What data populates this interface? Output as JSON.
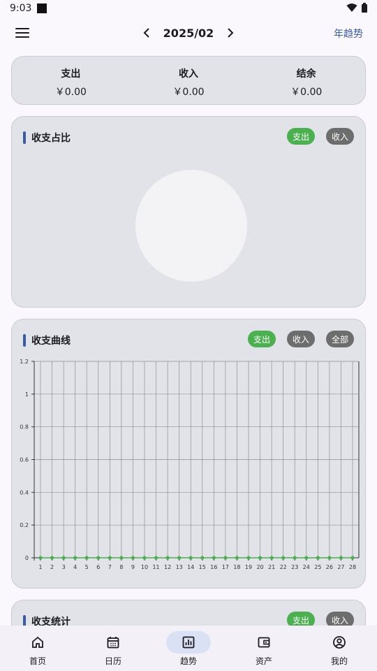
{
  "status": {
    "time": "9:03"
  },
  "header": {
    "month": "2025/02",
    "prev_icon": "chevron-left-icon",
    "next_icon": "chevron-right-icon",
    "year_trend": "年趋势"
  },
  "summary": [
    {
      "label": "支出",
      "value": "￥0.00"
    },
    {
      "label": "收入",
      "value": "￥0.00"
    },
    {
      "label": "结余",
      "value": "￥0.00"
    }
  ],
  "ratio_card": {
    "title": "收支占比",
    "chips": [
      "支出",
      "收入"
    ],
    "active": "支出"
  },
  "curve_card": {
    "title": "收支曲线",
    "chips": [
      "支出",
      "收入",
      "全部"
    ],
    "active": "支出"
  },
  "stat_card": {
    "title": "收支统计",
    "chips": [
      "支出",
      "收入"
    ],
    "active": "支出"
  },
  "chart_data": {
    "type": "line",
    "x": [
      1,
      2,
      3,
      4,
      5,
      6,
      7,
      8,
      9,
      10,
      11,
      12,
      13,
      14,
      15,
      16,
      17,
      18,
      19,
      20,
      21,
      22,
      23,
      24,
      25,
      26,
      27,
      28
    ],
    "series": [
      {
        "values": [
          0,
          0,
          0,
          0,
          0,
          0,
          0,
          0,
          0,
          0,
          0,
          0,
          0,
          0,
          0,
          0,
          0,
          0,
          0,
          0,
          0,
          0,
          0,
          0,
          0,
          0,
          0,
          0
        ],
        "color": "#4caf50"
      }
    ],
    "ylim": [
      0,
      1.2
    ],
    "yticks": [
      "0",
      "0.2",
      "0.4",
      "0.6",
      "0.8",
      "1",
      "1.2"
    ],
    "grid": true
  },
  "nav": [
    {
      "label": "首页",
      "icon": "home-icon"
    },
    {
      "label": "日历",
      "icon": "calendar-icon"
    },
    {
      "label": "趋势",
      "icon": "chart-icon",
      "active": true
    },
    {
      "label": "资产",
      "icon": "wallet-icon"
    },
    {
      "label": "我的",
      "icon": "profile-icon"
    }
  ],
  "colors": {
    "accent": "#3b5ba5",
    "active_chip": "#4caf50",
    "inactive_chip": "#6d6d6d",
    "card_bg": "#e2e3e8"
  }
}
